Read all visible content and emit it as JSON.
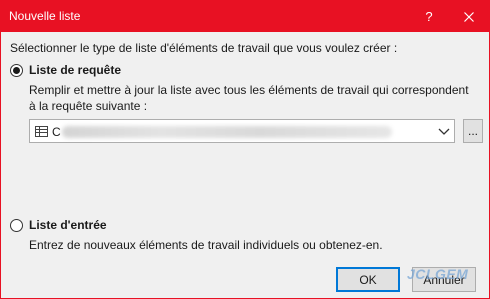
{
  "window": {
    "title": "Nouvelle liste",
    "help_label": "?",
    "close_label": "✕"
  },
  "instruction": "Sélectionner le type de liste d'éléments de travail que vous voulez créer :",
  "options": [
    {
      "label": "Liste de requête",
      "selected": true,
      "description_line1": "Remplir et mettre à jour la liste avec tous les éléments de travail qui correspondent",
      "description_line2": "à la requête suivante :"
    },
    {
      "label": "Liste d'entrée",
      "selected": false,
      "description_line1": "Entrez de nouveaux éléments de travail individuels ou obtenez-en."
    }
  ],
  "query_combo": {
    "value": "C",
    "icon": "list-icon",
    "arrow_icon": "chevron-down-icon"
  },
  "browse_button": {
    "label": "..."
  },
  "buttons": {
    "ok": "OK",
    "cancel": "Annuler"
  },
  "watermark": "JCLGEM",
  "colors": {
    "titlebar": "#e81123",
    "dialog_bg": "#f0f0f0",
    "focus_border": "#0078d7"
  }
}
